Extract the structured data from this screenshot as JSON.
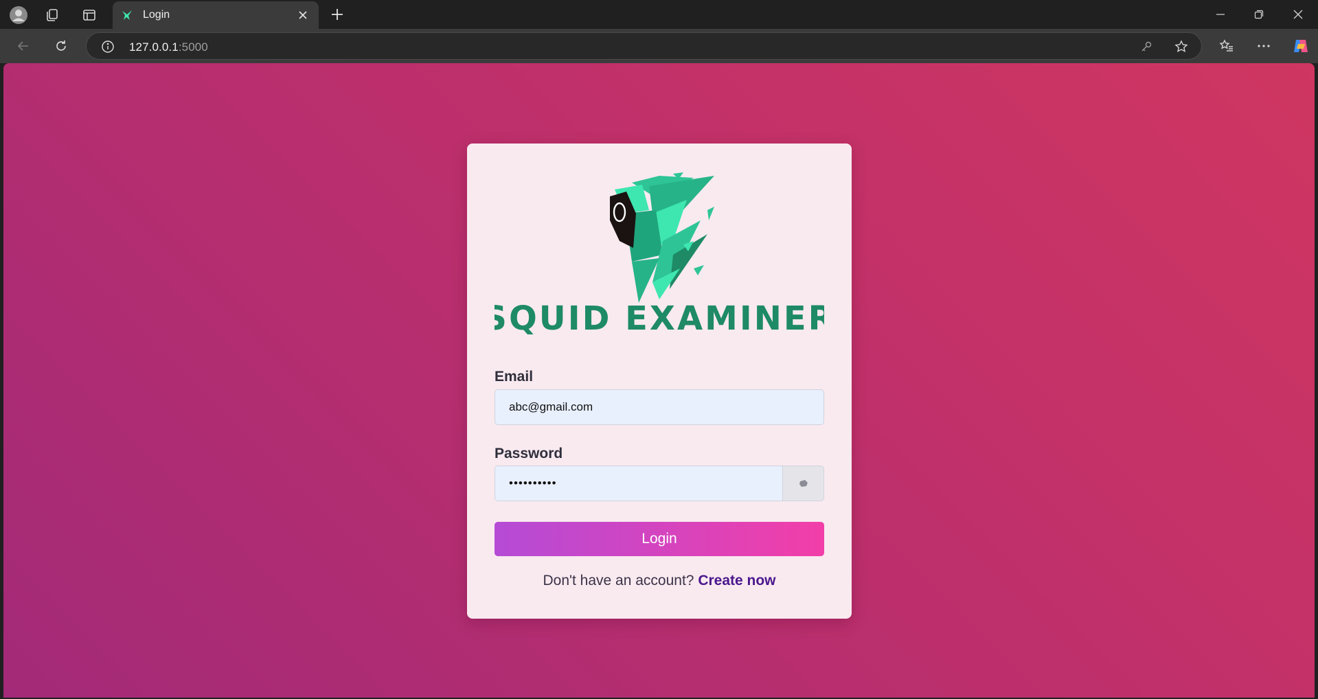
{
  "browser": {
    "tab_title": "Login",
    "url_host": "127.0.0.1",
    "url_port": ":5000"
  },
  "brand": {
    "logo_text": "SQUID EXAMINER",
    "primary_color": "#1e8a66",
    "accent_color": "#3ee6b0"
  },
  "form": {
    "email_label": "Email",
    "email_value": "abc@gmail.com",
    "password_label": "Password",
    "password_value": "••••••••••",
    "login_button": "Login",
    "signup_prompt": "Don't have an account?",
    "signup_link": "Create now"
  },
  "colors": {
    "background_top": "#cf3661",
    "background_bottom": "#a32a78",
    "button_start": "#b54bd6",
    "button_end": "#f23ea8"
  },
  "icons": [
    "profile-icon",
    "collections-icon",
    "tab-actions-icon",
    "close-icon",
    "new-tab-icon",
    "minimize-icon",
    "restore-icon",
    "window-close-icon",
    "back-icon",
    "refresh-icon",
    "info-icon",
    "key-icon",
    "favorite-icon",
    "favorites-list-icon",
    "more-icon",
    "copilot-icon",
    "eye-icon"
  ]
}
